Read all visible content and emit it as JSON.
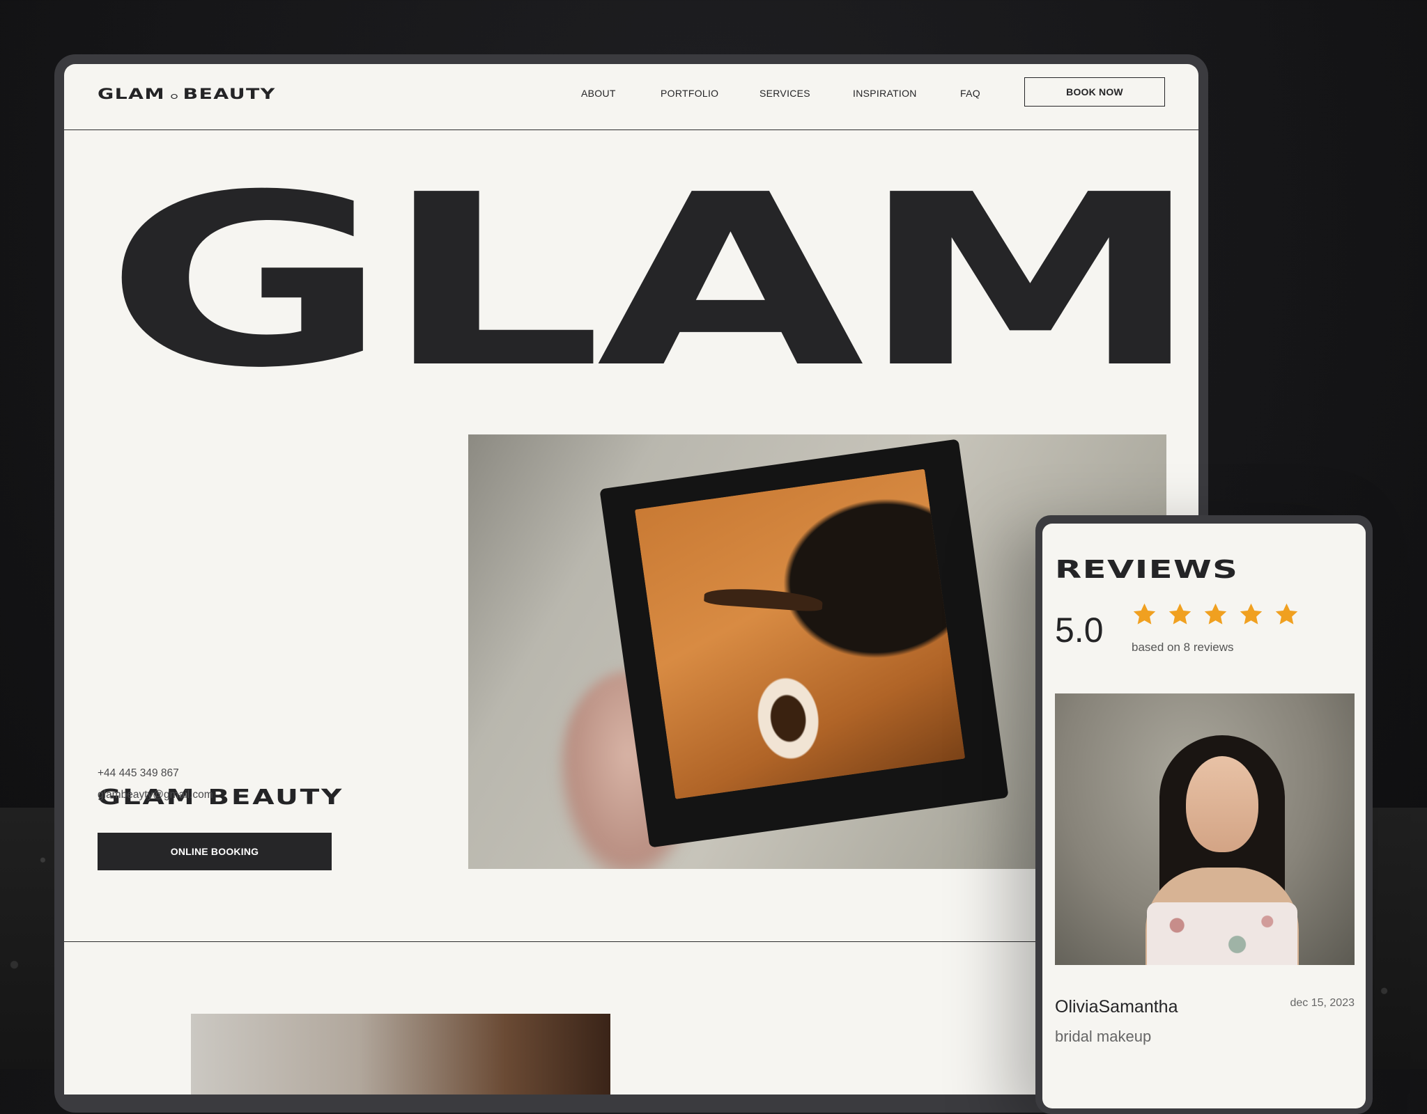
{
  "desktop": {
    "logo": {
      "part1": "GLAM",
      "part2": "BEAUTY"
    },
    "nav": {
      "items": [
        "ABOUT",
        "PORTFOLIO",
        "SERVICES",
        "INSPIRATION",
        "FAQ"
      ],
      "book_label": "BOOK NOW"
    },
    "hero": {
      "word": "GLAM",
      "brand": "GLAM BEAUTY",
      "phone": "+44 445 349 867",
      "email": "glambeayty@gmail.com",
      "booking_label": "ONLINE BOOKING"
    }
  },
  "mobile": {
    "reviews": {
      "title": "REVIEWS",
      "rating": "5.0",
      "stars": 5,
      "star_color": "#f0a020",
      "based_on": "based on 8 reviews",
      "review": {
        "name": "OliviaSamantha",
        "date": "dec 15, 2023",
        "service": "bridal makeup"
      }
    }
  }
}
